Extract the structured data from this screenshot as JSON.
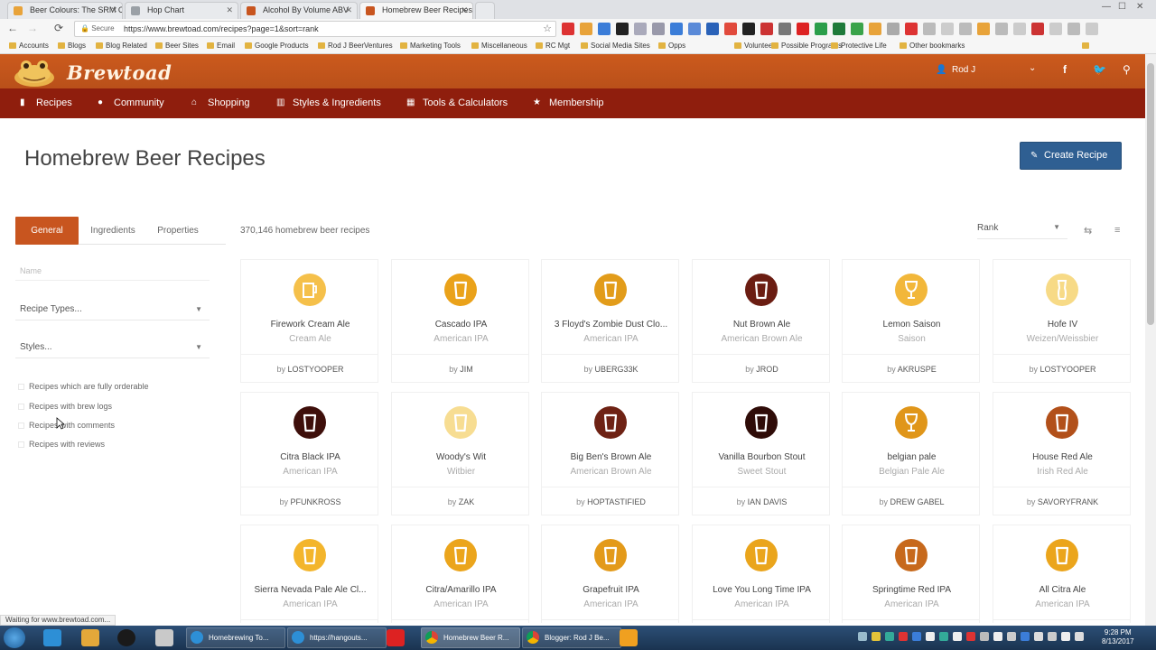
{
  "browser": {
    "tabs": [
      {
        "title": "Beer Colours: The SRM C",
        "fav": "#e8a33a",
        "active": false
      },
      {
        "title": "Hop Chart",
        "fav": "#9aa0a6",
        "active": false
      },
      {
        "title": "Alcohol By Volume ABV",
        "fav": "#c8551f",
        "active": false
      },
      {
        "title": "Homebrew Beer Recipes",
        "fav": "#c8551f",
        "active": true
      }
    ],
    "url": "https://www.brewtoad.com/recipes?page=1&sort=rank",
    "secure_label": "Secure",
    "bookmarks": [
      "Accounts",
      "Blogs",
      "Blog Related",
      "Beer Sites",
      "Email",
      "Google Products",
      "Rod J BeerVentures",
      "Marketing Tools",
      "Miscellaneous",
      "RC Mgt",
      "Social Media Sites",
      "Opps",
      "Volunteer",
      "Possible Programs",
      "Protective Life",
      "Other bookmarks"
    ],
    "status": "Waiting for www.brewtoad.com..."
  },
  "site": {
    "logo_text": "Brewtoad",
    "user_name": "Rod J",
    "nav": [
      {
        "label": "Recipes",
        "icon": "cup-icon"
      },
      {
        "label": "Community",
        "icon": "chat-icon"
      },
      {
        "label": "Shopping",
        "icon": "basket-icon"
      },
      {
        "label": "Styles & Ingredients",
        "icon": "chart-icon"
      },
      {
        "label": "Tools & Calculators",
        "icon": "calculator-icon"
      },
      {
        "label": "Membership",
        "icon": "star-icon"
      }
    ]
  },
  "page": {
    "title": "Homebrew Beer Recipes",
    "create_label": "Create Recipe",
    "filter_tabs": [
      "General",
      "Ingredients",
      "Properties"
    ],
    "name_placeholder": "Name",
    "recipe_types_label": "Recipe Types...",
    "styles_label": "Styles...",
    "checkboxes": [
      "Recipes which are fully orderable",
      "Recipes with brew logs",
      "Recipes with comments",
      "Recipes with reviews"
    ],
    "count_text": "370,146 homebrew beer recipes",
    "sort_value": "Rank"
  },
  "recipes": [
    {
      "name": "Firework Cream Ale",
      "style": "Cream Ale",
      "author": "LOSTYOOPER",
      "color": "#f5c04a",
      "glass": "mug"
    },
    {
      "name": "Cascado IPA",
      "style": "American IPA",
      "author": "JIM",
      "color": "#eaa21a",
      "glass": "pint"
    },
    {
      "name": "3 Floyd's Zombie Dust Clo...",
      "style": "American IPA",
      "author": "UBERG33K",
      "color": "#e29c1a",
      "glass": "pint"
    },
    {
      "name": "Nut Brown Ale",
      "style": "American Brown Ale",
      "author": "JROD",
      "color": "#6b1d12",
      "glass": "pint"
    },
    {
      "name": "Lemon Saison",
      "style": "Saison",
      "author": "AKRUSPE",
      "color": "#f2b73a",
      "glass": "tulip"
    },
    {
      "name": "Hofe IV",
      "style": "Weizen/Weissbier",
      "author": "LOSTYOOPER",
      "color": "#f7da86",
      "glass": "weizen"
    },
    {
      "name": "Citra Black IPA",
      "style": "American IPA",
      "author": "PFUNKROSS",
      "color": "#3e0f0b",
      "glass": "pint"
    },
    {
      "name": "Woody's Wit",
      "style": "Witbier",
      "author": "ZAK",
      "color": "#f7dd92",
      "glass": "pint"
    },
    {
      "name": "Big Ben's Brown Ale",
      "style": "American Brown Ale",
      "author": "HOPTASTIFIED",
      "color": "#6e2214",
      "glass": "pint"
    },
    {
      "name": "Vanilla Bourbon Stout",
      "style": "Sweet Stout",
      "author": "IAN DAVIS",
      "color": "#2f0c08",
      "glass": "pint"
    },
    {
      "name": "belgian pale",
      "style": "Belgian Pale Ale",
      "author": "DREW GABEL",
      "color": "#e0961a",
      "glass": "tulip"
    },
    {
      "name": "House Red Ale",
      "style": "Irish Red Ale",
      "author": "SAVORYFRANK",
      "color": "#b2501a",
      "glass": "pint"
    },
    {
      "name": "Sierra Nevada Pale Ale Cl...",
      "style": "American IPA",
      "author": "",
      "color": "#f3b52c",
      "glass": "pint"
    },
    {
      "name": "Citra/Amarillo IPA",
      "style": "American IPA",
      "author": "",
      "color": "#eba51c",
      "glass": "pint"
    },
    {
      "name": "Grapefruit IPA",
      "style": "American IPA",
      "author": "",
      "color": "#e39a1a",
      "glass": "pint"
    },
    {
      "name": "Love You Long Time IPA",
      "style": "American IPA",
      "author": "",
      "color": "#eaa51c",
      "glass": "pint"
    },
    {
      "name": "Springtime Red IPA",
      "style": "American IPA",
      "author": "",
      "color": "#c7691c",
      "glass": "pint"
    },
    {
      "name": "All Citra Ale",
      "style": "American IPA",
      "author": "",
      "color": "#eba51c",
      "glass": "pint"
    }
  ],
  "taskbar": {
    "tasks": [
      "Homebrewing To...",
      "https://hangouts...",
      "Homebrew Beer R...",
      "Blogger: Rod J Be..."
    ],
    "time": "9:28 PM",
    "date": "8/13/2017"
  }
}
